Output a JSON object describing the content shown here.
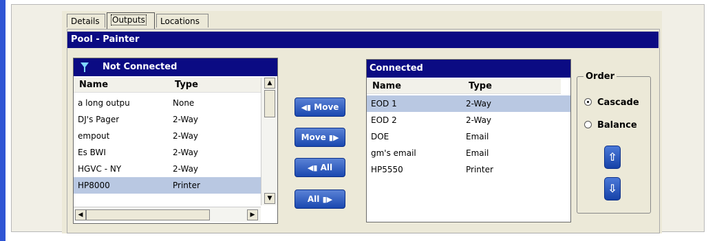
{
  "tabs": [
    {
      "label": "Details",
      "active": false
    },
    {
      "label": "Outputs",
      "active": true
    },
    {
      "label": "Locations",
      "active": false
    }
  ],
  "pool_title": "Pool - Painter",
  "not_connected": {
    "title": "Not Connected",
    "columns": [
      "Name",
      "Type"
    ],
    "rows": [
      {
        "name": "a long outpu",
        "type": "None"
      },
      {
        "name": "DJ's Pager",
        "type": "2-Way"
      },
      {
        "name": "empout",
        "type": "2-Way"
      },
      {
        "name": "Es BWI",
        "type": "2-Way"
      },
      {
        "name": "HGVC - NY",
        "type": "2-Way"
      },
      {
        "name": "HP8000",
        "type": "Printer",
        "selected": true
      }
    ]
  },
  "move_buttons": {
    "move_left": "Move",
    "move_right": "Move",
    "all_left": "All",
    "all_right": "All"
  },
  "connected": {
    "title": "Connected",
    "columns": [
      "Name",
      "Type"
    ],
    "rows": [
      {
        "name": "EOD 1",
        "type": "2-Way",
        "selected": true
      },
      {
        "name": "EOD 2",
        "type": "2-Way"
      },
      {
        "name": "DOE",
        "type": "Email"
      },
      {
        "name": "gm's email",
        "type": "Email"
      },
      {
        "name": "HP5550",
        "type": "Printer"
      }
    ]
  },
  "order": {
    "legend": "Order",
    "options": [
      "Cascade",
      "Balance"
    ],
    "selected": "Cascade"
  },
  "icons": [
    "funnel-icon",
    "arrow-left-icon",
    "arrow-right-icon",
    "arrow-up-icon",
    "arrow-down-icon"
  ],
  "colors": {
    "header_bg": "#0b0b83",
    "selection": "#b9c8e2",
    "button": "#2a5bc4"
  }
}
